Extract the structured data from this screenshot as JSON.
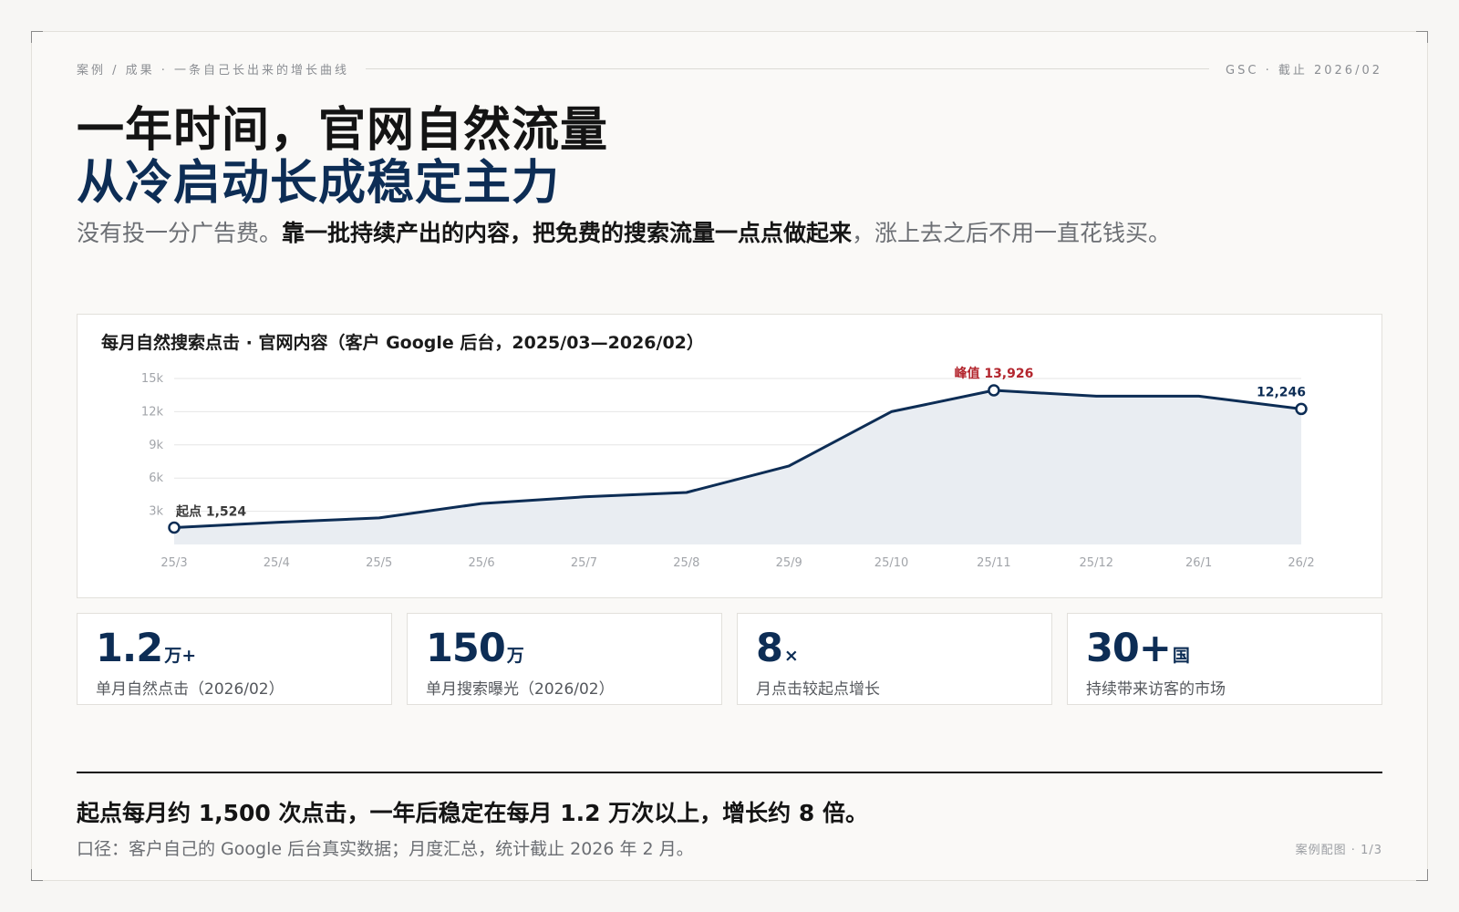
{
  "header": {
    "breadcrumb": "案例 / 成果 · 一条自己长出来的增长曲线",
    "source_tag": "GSC · 截止 2026/02"
  },
  "title_line1": "一年时间，官网自然流量",
  "title_line2": "从冷启动长成稳定主力",
  "lead": {
    "part1": "没有投一分广告费。",
    "bold": "靠一批持续产出的内容，把免费的搜索流量一点点做起来",
    "part2": "，涨上去之后不用一直花钱买。"
  },
  "chart_data": {
    "type": "area",
    "title": "每月自然搜索点击 · 官网内容（客户 Google 后台，2025/03—2026/02）",
    "categories": [
      "25/3",
      "25/4",
      "25/5",
      "25/6",
      "25/7",
      "25/8",
      "25/9",
      "25/10",
      "25/11",
      "25/12",
      "26/1",
      "26/2"
    ],
    "values": [
      1524,
      2000,
      2400,
      3700,
      4300,
      4700,
      7100,
      12000,
      13926,
      13400,
      13400,
      12246
    ],
    "ylim": [
      0,
      15000
    ],
    "yticks": [
      3000,
      6000,
      9000,
      12000,
      15000
    ],
    "ytick_labels": [
      "3k",
      "6k",
      "9k",
      "12k",
      "15k"
    ],
    "grid": true,
    "annotations": {
      "start": "起点 1,524",
      "peak": "峰值 13,926",
      "end": "12,246"
    },
    "colors": {
      "line": "#0d2d55",
      "fill": "#e9edf2",
      "peak_label": "#b3262e",
      "grid": "#e6e6e6",
      "tick": "#a2a5aa"
    }
  },
  "stats": [
    {
      "value": "1.2",
      "unit": "万+",
      "label": "单月自然点击（2026/02）"
    },
    {
      "value": "150",
      "unit": "万",
      "label": "单月搜索曝光（2026/02）"
    },
    {
      "value": "8",
      "unit": "×",
      "label": "月点击较起点增长"
    },
    {
      "value": "30+",
      "unit": "国",
      "label": "持续带来访客的市场"
    }
  ],
  "summary": "起点每月约 1,500 次点击，一年后稳定在每月 1.2 万次以上，增长约 8 倍。",
  "note": "口径：客户自己的 Google 后台真实数据；月度汇总，统计截止 2026 年 2 月。",
  "pager": "案例配图 · 1/3"
}
